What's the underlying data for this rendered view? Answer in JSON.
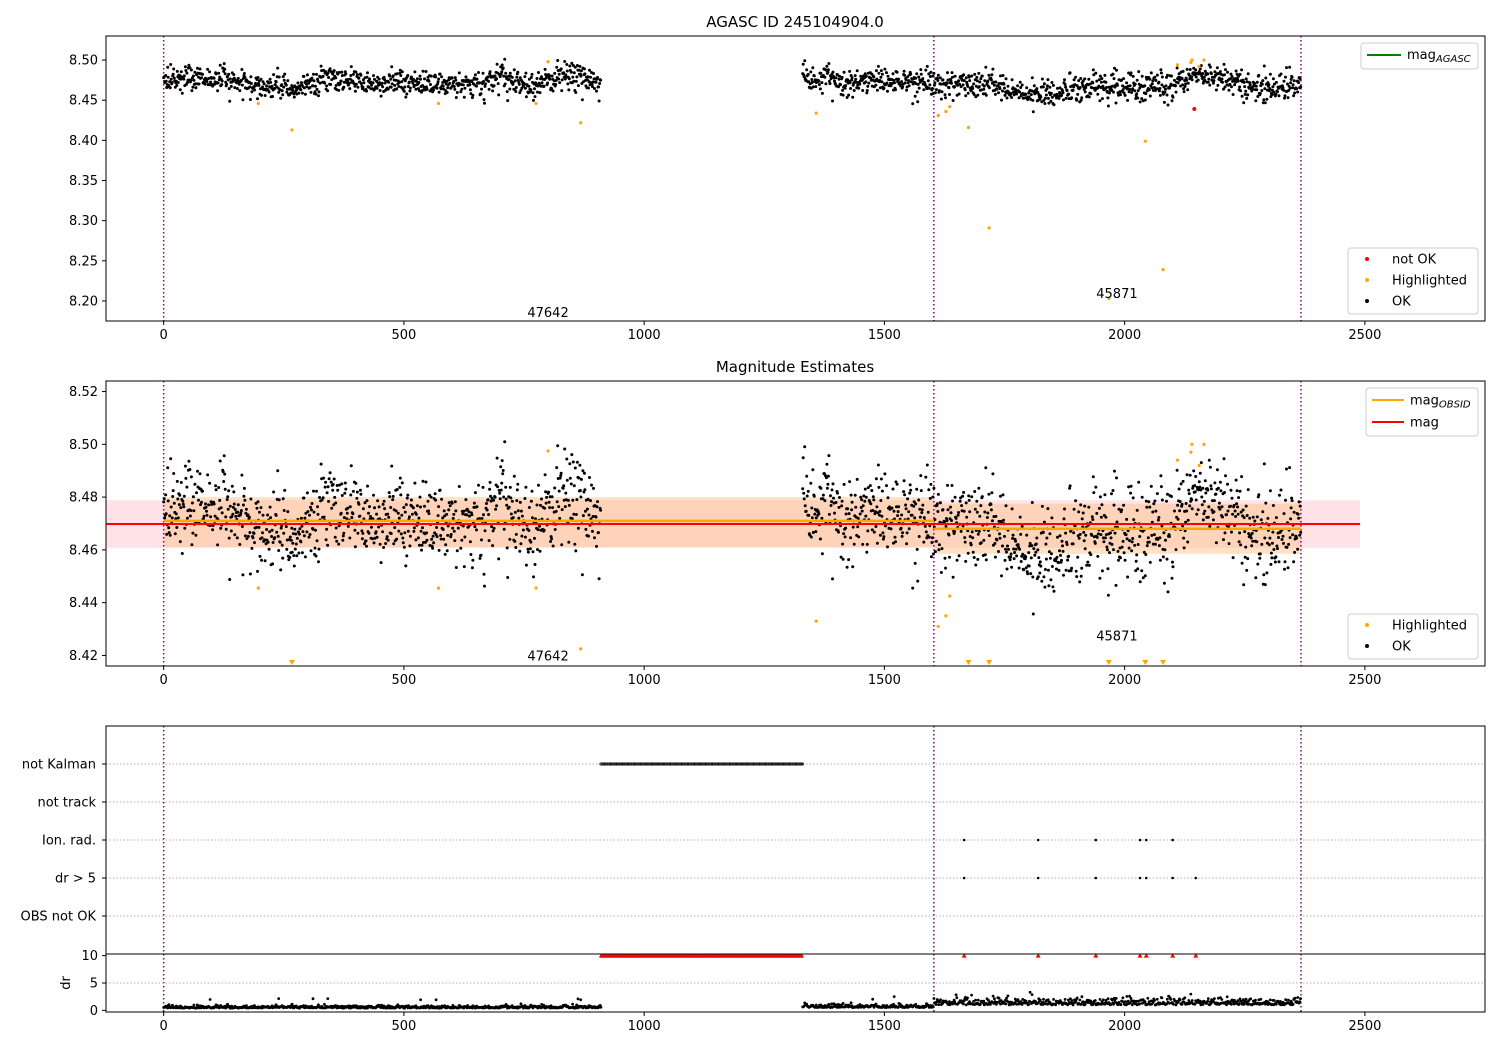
{
  "colors": {
    "ok": "#000000",
    "highlighted": "#ffa500",
    "not_ok": "#ff0000",
    "mag_agasc": "#008000",
    "mag_obsid": "#ffa500",
    "mag": "#ff0000",
    "obsid_boundary": "#800080",
    "band_red": "#ffc0cb",
    "band_orange": "#ffc48c"
  },
  "chart_data": [
    {
      "type": "scatter",
      "title": "AGASC ID 245104904.0",
      "xlim": [
        -120,
        2750
      ],
      "ylim": [
        8.175,
        8.53
      ],
      "xticks": [
        "0",
        "500",
        "1000",
        "1500",
        "2000",
        "2500"
      ],
      "yticks": [
        "8.20",
        "8.25",
        "8.30",
        "8.35",
        "8.40",
        "8.45",
        "8.50"
      ],
      "obsid_boundaries": [
        0,
        1603,
        2367
      ],
      "obsid_labels": [
        {
          "text": "47642",
          "x": 800,
          "y": 8.186
        },
        {
          "text": "45871",
          "x": 1984,
          "y": 8.21
        }
      ],
      "series": [
        {
          "name": "OK",
          "segments": [
            {
              "x_start": 0,
              "x_end": 910,
              "level": [
                [
                  0,
                  8.472
                ],
                [
                  100,
                  8.478
                ],
                [
                  150,
                  8.472
                ],
                [
                  260,
                  8.464
                ],
                [
                  340,
                  8.476
                ],
                [
                  450,
                  8.471
                ],
                [
                  640,
                  8.471
                ],
                [
                  700,
                  8.478
                ],
                [
                  760,
                  8.467
                ],
                [
                  850,
                  8.482
                ],
                [
                  910,
                  8.466
                ]
              ]
            },
            {
              "x_start": 1330,
              "x_end": 2367,
              "level": [
                [
                  1330,
                  8.477
                ],
                [
                  1450,
                  8.475
                ],
                [
                  1603,
                  8.47
                ],
                [
                  1700,
                  8.472
                ],
                [
                  1820,
                  8.457
                ],
                [
                  1920,
                  8.467
                ],
                [
                  2100,
                  8.465
                ],
                [
                  2140,
                  8.484
                ],
                [
                  2220,
                  8.475
                ],
                [
                  2300,
                  8.465
                ],
                [
                  2367,
                  8.47
                ]
              ]
            }
          ]
        },
        {
          "name": "Highlighted",
          "points": [
            [
              197,
              8.446
            ],
            [
              267,
              8.413
            ],
            [
              572,
              8.446
            ],
            [
              775,
              8.446
            ],
            [
              800,
              8.498
            ],
            [
              868,
              8.422
            ],
            [
              1358,
              8.434
            ],
            [
              1612,
              8.431
            ],
            [
              1628,
              8.436
            ],
            [
              1636,
              8.442
            ],
            [
              1675,
              8.416
            ],
            [
              1718,
              8.291
            ],
            [
              1967,
              8.203
            ],
            [
              2043,
              8.399
            ],
            [
              2080,
              8.239
            ],
            [
              2110,
              8.494
            ],
            [
              2138,
              8.497
            ],
            [
              2140,
              8.5
            ],
            [
              2155,
              8.492
            ],
            [
              2165,
              8.5
            ]
          ]
        },
        {
          "name": "not OK",
          "points": [
            [
              2145,
              8.439
            ]
          ]
        }
      ],
      "lines": [
        {
          "name": "mag_AGASC",
          "y": 8.471
        }
      ],
      "legend": {
        "upper": [
          {
            "label": "mag",
            "sub": "AGASC",
            "kind": "line",
            "color": "#008000"
          }
        ],
        "lower": [
          {
            "label": "not OK",
            "kind": "point",
            "color": "#ff0000"
          },
          {
            "label": "Highlighted",
            "kind": "point",
            "color": "#ffa500"
          },
          {
            "label": "OK",
            "kind": "point",
            "color": "#000000"
          }
        ]
      }
    },
    {
      "type": "scatter",
      "title": "Magnitude Estimates",
      "xlim": [
        -120,
        2750
      ],
      "ylim": [
        8.416,
        8.524
      ],
      "xticks": [
        "0",
        "500",
        "1000",
        "1500",
        "2000",
        "2500"
      ],
      "yticks": [
        "8.42",
        "8.44",
        "8.46",
        "8.48",
        "8.50",
        "8.52"
      ],
      "obsid_boundaries": [
        0,
        1603,
        2367
      ],
      "obsid_labels": [
        {
          "text": "47642",
          "x": 800,
          "y": 8.42
        },
        {
          "text": "45871",
          "x": 1984,
          "y": 8.4275
        }
      ],
      "series": [
        {
          "name": "OK",
          "segments": [
            {
              "x_start": 0,
              "x_end": 910,
              "level": [
                [
                  0,
                  8.472
                ],
                [
                  100,
                  8.478
                ],
                [
                  150,
                  8.472
                ],
                [
                  260,
                  8.464
                ],
                [
                  340,
                  8.476
                ],
                [
                  450,
                  8.471
                ],
                [
                  640,
                  8.471
                ],
                [
                  700,
                  8.478
                ],
                [
                  760,
                  8.467
                ],
                [
                  850,
                  8.482
                ],
                [
                  910,
                  8.466
                ]
              ]
            },
            {
              "x_start": 1330,
              "x_end": 2367,
              "level": [
                [
                  1330,
                  8.477
                ],
                [
                  1450,
                  8.475
                ],
                [
                  1603,
                  8.47
                ],
                [
                  1700,
                  8.472
                ],
                [
                  1820,
                  8.457
                ],
                [
                  1920,
                  8.467
                ],
                [
                  2100,
                  8.465
                ],
                [
                  2140,
                  8.484
                ],
                [
                  2220,
                  8.475
                ],
                [
                  2300,
                  8.465
                ],
                [
                  2367,
                  8.47
                ]
              ]
            }
          ]
        },
        {
          "name": "Highlighted",
          "points": [
            [
              197,
              8.4455
            ],
            [
              572,
              8.4455
            ],
            [
              775,
              8.4455
            ],
            [
              800,
              8.4975
            ],
            [
              868,
              8.4225
            ],
            [
              1358,
              8.433
            ],
            [
              1612,
              8.431
            ],
            [
              1628,
              8.435
            ],
            [
              1636,
              8.4425
            ],
            [
              2110,
              8.494
            ],
            [
              2138,
              8.497
            ],
            [
              2140,
              8.5
            ],
            [
              2155,
              8.492
            ],
            [
              2165,
              8.5
            ]
          ]
        },
        {
          "name": "Highlighted (below range)",
          "markers": [
            267,
            1675,
            1718,
            1967,
            2043,
            2080
          ]
        }
      ],
      "lines": [
        {
          "name": "mag_OBSID",
          "segments": [
            {
              "x_start": 0,
              "x_end": 1603,
              "y": 8.471
            },
            {
              "x_start": 1603,
              "x_end": 2367,
              "y": 8.468
            }
          ]
        },
        {
          "name": "mag",
          "x_start": -120,
          "x_end": 2490,
          "y": 8.4698
        }
      ],
      "bands": [
        {
          "x_start": -120,
          "x_end": 2490,
          "y_low": 8.4608,
          "y_high": 8.4788,
          "color": "band_red"
        },
        {
          "x_start": 0,
          "x_end": 1603,
          "y_low": 8.461,
          "y_high": 8.48,
          "color": "band_orange"
        },
        {
          "x_start": 1603,
          "x_end": 2367,
          "y_low": 8.4585,
          "y_high": 8.4775,
          "color": "band_orange"
        }
      ],
      "legend": {
        "upper": [
          {
            "label": "mag",
            "sub": "OBSID",
            "kind": "line",
            "color": "#ffa500"
          },
          {
            "label": "mag",
            "sub": "",
            "kind": "line",
            "color": "#ff0000"
          }
        ],
        "lower": [
          {
            "label": "Highlighted",
            "kind": "point",
            "color": "#ffa500"
          },
          {
            "label": "OK",
            "kind": "point",
            "color": "#000000"
          }
        ]
      }
    },
    {
      "type": "scatter",
      "title": "",
      "xlim": [
        -120,
        2750
      ],
      "categories": [
        "not Kalman",
        "not track",
        "Ion. rad.",
        "dr > 5",
        "OBS not OK"
      ],
      "obsid_boundaries": [
        0,
        1603,
        2367
      ],
      "flags": {
        "not Kalman": {
          "x_start": 910,
          "x_end": 1330
        },
        "not track": {
          "points": []
        },
        "Ion. rad.": {
          "points": [
            1666,
            1820,
            1940,
            2032,
            2045,
            2100
          ]
        },
        "dr > 5": {
          "points": [
            1666,
            1820,
            1940,
            2032,
            2045,
            2100,
            2148
          ]
        },
        "OBS not OK": {
          "points": []
        }
      }
    },
    {
      "type": "scatter",
      "title": "",
      "xlim": [
        -120,
        2750
      ],
      "ylim": [
        -0.3,
        10.3
      ],
      "ylabel": "dr",
      "xticks": [
        "0",
        "500",
        "1000",
        "1500",
        "2000",
        "2500"
      ],
      "yticks": [
        "0",
        "5",
        "10"
      ],
      "obsid_boundaries": [
        0,
        1603,
        2367
      ],
      "series": [
        {
          "name": "dr",
          "segments": [
            {
              "x_start": 0,
              "x_end": 910,
              "mean": 0.4
            },
            {
              "x_start": 1330,
              "x_end": 1603,
              "mean": 0.5
            },
            {
              "x_start": 1603,
              "x_end": 2367,
              "mean": 1.0
            }
          ]
        },
        {
          "name": "dr clipped",
          "x_start": 910,
          "x_end": 1330,
          "points": [
            1666,
            1820,
            1940,
            2032,
            2045,
            2100,
            2148
          ],
          "y": 10
        }
      ]
    }
  ]
}
